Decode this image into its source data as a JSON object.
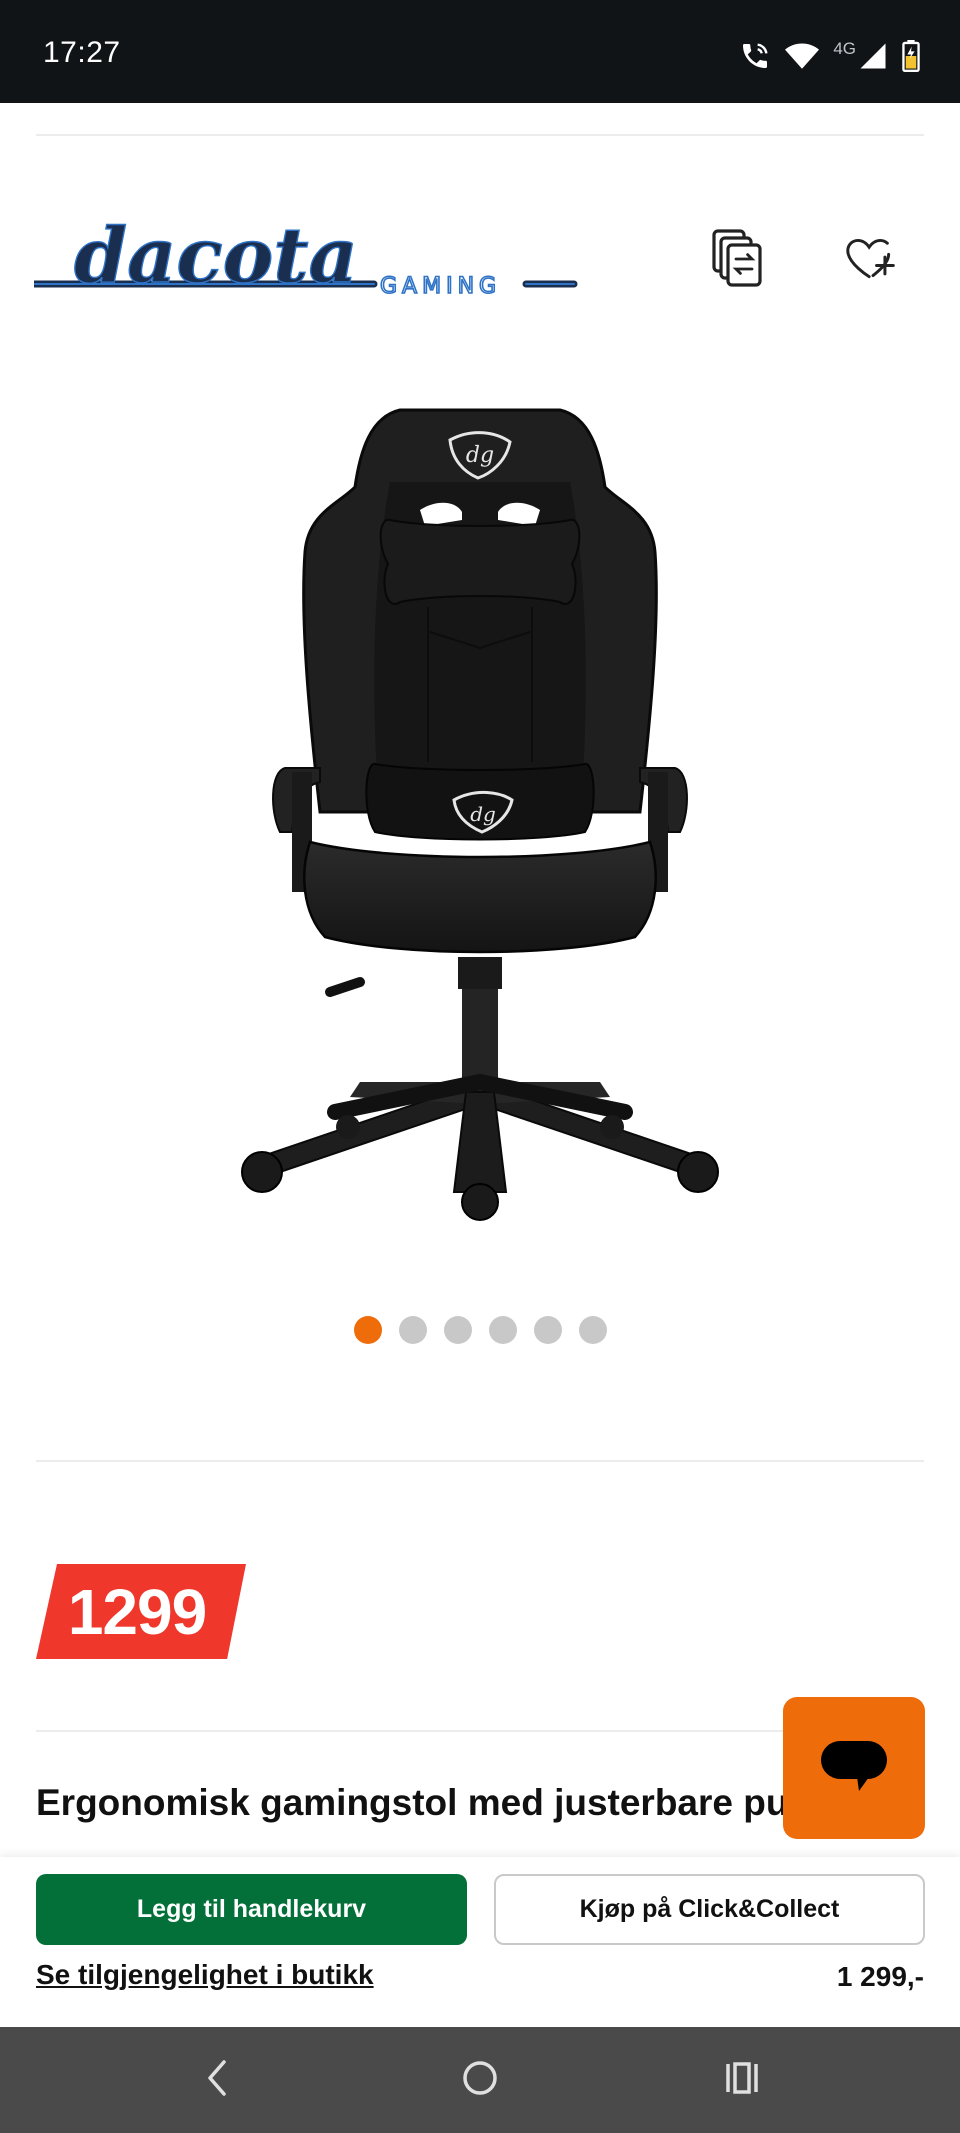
{
  "status_bar": {
    "time": "17:27",
    "network": "4G",
    "icons": [
      "wifi-calling-icon",
      "wifi-icon",
      "signal-icon",
      "battery-icon"
    ]
  },
  "brand": {
    "logo_main": "dacota",
    "logo_sub": "GAMING",
    "logo_color": "#1a2e4f",
    "logo_accent": "#2f73c7"
  },
  "header_icons": [
    "compare-icon",
    "heart-plus-icon"
  ],
  "carousel": {
    "total": 6,
    "active": 1,
    "active_color": "#ef6c0b",
    "inactive_color": "#c8c8c8"
  },
  "price": {
    "badge": "1299",
    "badge_color": "#f0372b"
  },
  "product": {
    "title": "Ergonomisk gamingstol med justerbare puter"
  },
  "chat": {
    "icon": "chat-bubble-icon",
    "color": "#ef6c0b"
  },
  "actions": {
    "add_to_cart": "Legg til handlekurv",
    "add_to_cart_color": "#037039",
    "click_collect": "Kjøp på Click&Collect",
    "availability": "Se tilgjengelighet i butikk",
    "price": "1 299,-"
  },
  "nav": {
    "icons": [
      "back-icon",
      "home-icon",
      "recents-icon"
    ]
  }
}
